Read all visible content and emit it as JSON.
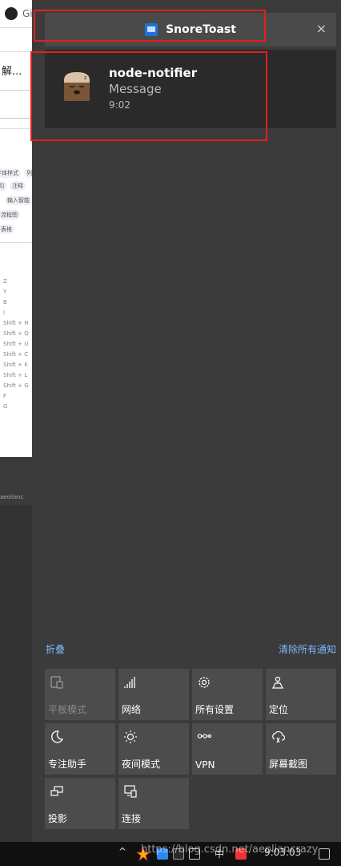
{
  "background_window": {
    "tab_text": "Gi",
    "text_jie": "解...",
    "chips": [
      "字体样式",
      "列",
      "引",
      "注释",
      "输入智能",
      "流程图",
      "表格"
    ],
    "shortcuts": [
      "Z",
      "Y",
      "B",
      "I",
      "Shift + H",
      "Shift + Q",
      "Shift + U",
      "Shift + C",
      "Shift + K",
      "Shift + L",
      "Shift + G",
      "F",
      "G"
    ],
    "dark_text": "aeolianc"
  },
  "notification": {
    "app_name": "SnoreToast",
    "close_glyph": "×",
    "title": "node-notifier",
    "message": "Message",
    "time": "9:02"
  },
  "action_center": {
    "collapse_label": "折叠",
    "clear_all_label": "清除所有通知",
    "tiles": [
      {
        "label": "平板模式",
        "icon": "tablet-mode-icon",
        "disabled": true
      },
      {
        "label": "网络",
        "icon": "network-icon"
      },
      {
        "label": "所有设置",
        "icon": "settings-gear-icon"
      },
      {
        "label": "定位",
        "icon": "location-icon"
      },
      {
        "label": "专注助手",
        "icon": "moon-icon"
      },
      {
        "label": "夜间模式",
        "icon": "brightness-icon"
      },
      {
        "label": "VPN",
        "icon": "vpn-icon"
      },
      {
        "label": "屏幕截图",
        "icon": "screen-snip-icon"
      },
      {
        "label": "投影",
        "icon": "project-icon"
      },
      {
        "label": "连接",
        "icon": "connect-icon"
      }
    ]
  },
  "taskbar": {
    "chevron": "^",
    "ime": "中",
    "clock": "9:03:03",
    "watermark": "https://blog.csdn.net/aeoliancrazy"
  },
  "colors": {
    "accent_link": "#7fb6ff",
    "annotation_red": "#e0201e",
    "tile_bg": "#4c4c4c",
    "panel_bg": "#3b3b3b"
  }
}
